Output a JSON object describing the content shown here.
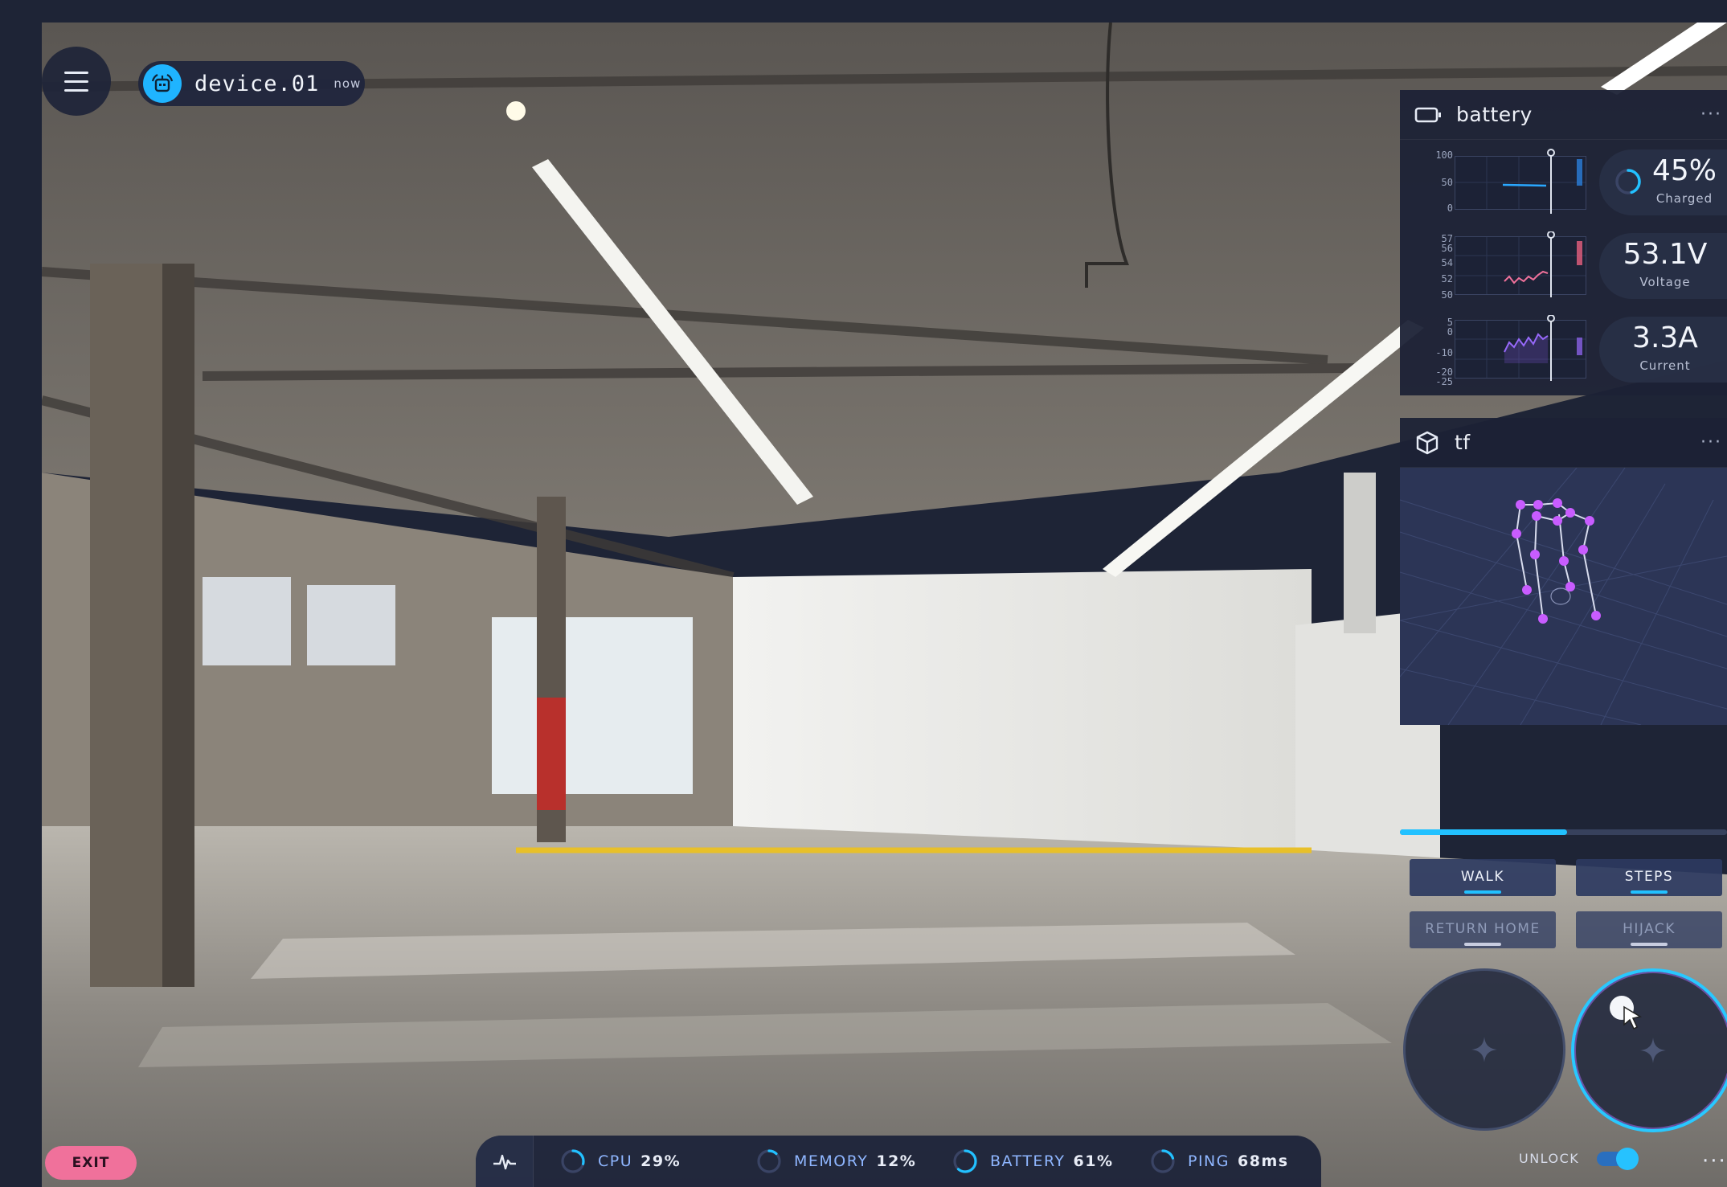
{
  "header": {
    "device_name": "device.01",
    "device_time": "now"
  },
  "battery": {
    "title": "battery",
    "rows": [
      {
        "ticks": [
          "100",
          "50",
          "0"
        ],
        "value": "45%",
        "label": "Charged",
        "level": 0.45
      },
      {
        "ticks": [
          "57",
          "56",
          "54",
          "52",
          "50"
        ],
        "value": "53.1V",
        "label": "Voltage"
      },
      {
        "ticks": [
          "5",
          "0",
          "-10",
          "-20",
          "-25"
        ],
        "value": "3.3A",
        "label": "Current"
      }
    ]
  },
  "tf": {
    "title": "tf"
  },
  "speed": {
    "level": 0.51
  },
  "modes": {
    "walk": "WALK",
    "steps": "STEPS",
    "return_home": "RETURN HOME",
    "hijack": "HIJACK"
  },
  "controls": {
    "exit": "EXIT",
    "unlock": "UNLOCK"
  },
  "status": [
    {
      "label": "CPU",
      "value": "29%",
      "level": 0.29
    },
    {
      "label": "MEMORY",
      "value": "12%",
      "level": 0.12
    },
    {
      "label": "BATTERY",
      "value": "61%",
      "level": 0.61
    },
    {
      "label": "PING",
      "value": "68ms",
      "level": 0.2
    }
  ],
  "colors": {
    "accent": "#22c1ff",
    "exit": "#f0719b",
    "voltage_line": "#f0719b",
    "current_line": "#9b6cff",
    "joint": "#c85cff"
  },
  "icons": {
    "menu": "menu-icon",
    "device": "robot-icon",
    "battery": "battery-icon",
    "tf": "cube-icon",
    "pulse": "pulse-icon",
    "joystick": "sparkle-icon"
  }
}
